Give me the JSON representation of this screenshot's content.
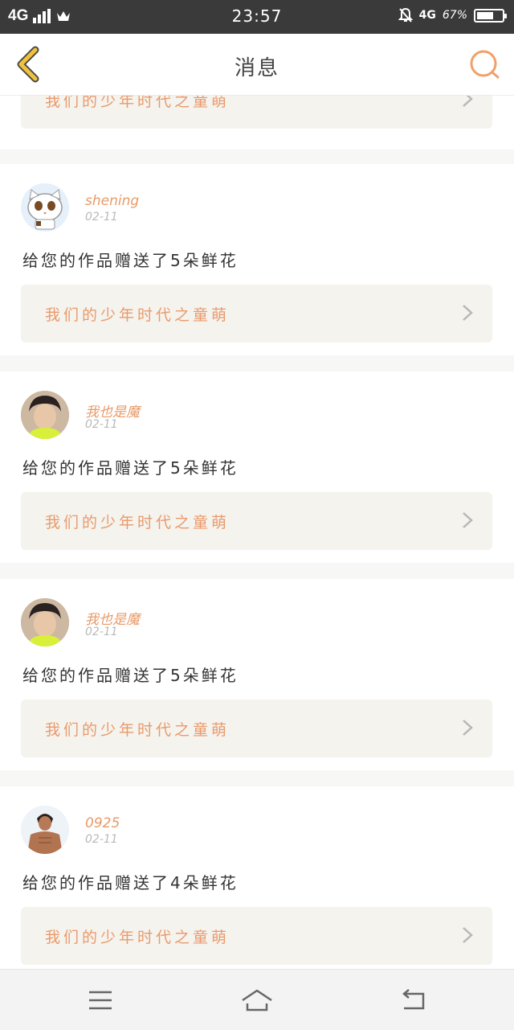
{
  "status_bar": {
    "network": "4G",
    "time": "23:57",
    "network_right": "4G",
    "battery_text": "67%",
    "battery_level": 0.67
  },
  "header": {
    "title": "消息"
  },
  "colors": {
    "accent": "#e89a68",
    "back_arrow": "#f0c23a"
  },
  "messages": [
    {
      "work_title": "我们的少年时代之童萌"
    },
    {
      "user": "shening",
      "date": "02-11",
      "text": "给您的作品赠送了5朵鲜花",
      "work_title": "我们的少年时代之童萌",
      "avatar": "cartoon-cat"
    },
    {
      "user": "我也是魔",
      "date": "02-11",
      "text": "给您的作品赠送了5朵鲜花",
      "work_title": "我们的少年时代之童萌",
      "avatar": "boy-photo"
    },
    {
      "user": "我也是魔",
      "date": "02-11",
      "text": "给您的作品赠送了5朵鲜花",
      "work_title": "我们的少年时代之童萌",
      "avatar": "boy-photo"
    },
    {
      "user": "0925",
      "date": "02-11",
      "text": "给您的作品赠送了4朵鲜花",
      "work_title": "我们的少年时代之童萌",
      "avatar": "man-photo"
    }
  ],
  "nav": {
    "icons": [
      "menu-icon",
      "home-icon",
      "back-icon"
    ]
  }
}
